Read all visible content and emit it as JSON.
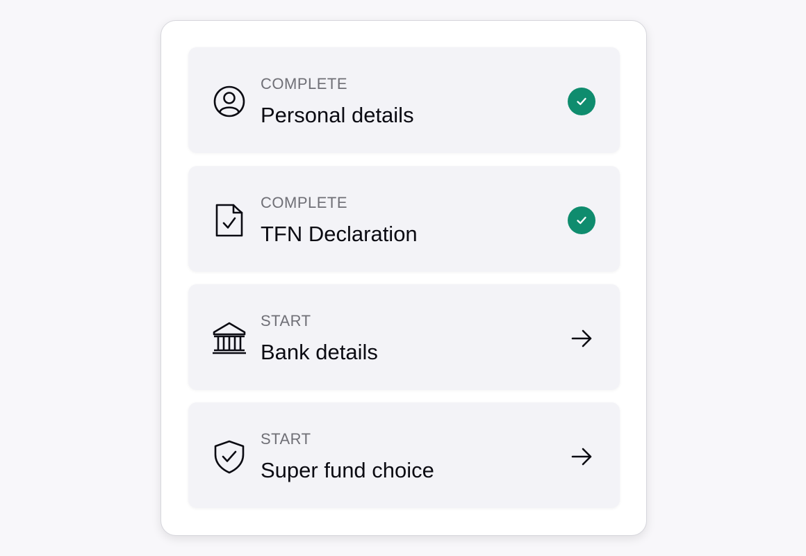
{
  "colors": {
    "complete_badge": "#0f8c6e",
    "text_primary": "#0b0b12",
    "text_secondary": "#6f6f76"
  },
  "tasks": [
    {
      "status": "COMPLETE",
      "title": "Personal details",
      "icon": "user-circle-icon",
      "indicator": "check"
    },
    {
      "status": "COMPLETE",
      "title": "TFN Declaration",
      "icon": "document-check-icon",
      "indicator": "check"
    },
    {
      "status": "START",
      "title": "Bank details",
      "icon": "bank-icon",
      "indicator": "arrow"
    },
    {
      "status": "START",
      "title": "Super fund choice",
      "icon": "shield-check-icon",
      "indicator": "arrow"
    }
  ]
}
